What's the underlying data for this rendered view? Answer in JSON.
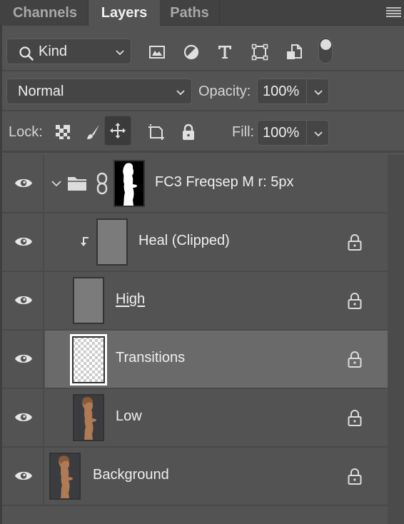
{
  "tabs": [
    {
      "label": "Channels",
      "active": false
    },
    {
      "label": "Layers",
      "active": true
    },
    {
      "label": "Paths",
      "active": false
    }
  ],
  "panel_menu_icon": "hamburger-menu-icon",
  "filter": {
    "kind_label": "Kind",
    "icons": [
      "image-filter-icon",
      "adjustment-filter-icon",
      "type-filter-icon",
      "shape-filter-icon",
      "smart-object-filter-icon"
    ],
    "filter_toggle_on": true
  },
  "blend": {
    "mode": "Normal",
    "opacity_label": "Opacity:",
    "opacity_value": "100%"
  },
  "lock": {
    "label": "Lock:",
    "icons": [
      "lock-transparent-pixels-icon",
      "lock-image-pixels-icon",
      "lock-position-icon",
      "lock-artboard-icon",
      "lock-all-icon"
    ],
    "selected": "lock-position-icon",
    "fill_label": "Fill:",
    "fill_value": "100%"
  },
  "layers": [
    {
      "name": "FC3 Freqsep M  r: 5px",
      "type": "group",
      "visible": true,
      "expanded": true,
      "linked_mask": true,
      "locked": false,
      "active": false,
      "underlined": false
    },
    {
      "name": "Heal (Clipped)",
      "type": "gray",
      "visible": true,
      "clipped": true,
      "locked": true,
      "active": false,
      "underlined": false
    },
    {
      "name": "High",
      "type": "gray",
      "visible": true,
      "locked": true,
      "active": false,
      "underlined": true
    },
    {
      "name": "Transitions",
      "type": "transparent",
      "visible": true,
      "locked": true,
      "active": true,
      "underlined": false
    },
    {
      "name": "Low",
      "type": "photo",
      "visible": true,
      "locked": true,
      "active": false,
      "underlined": false
    },
    {
      "name": "Background",
      "type": "photo",
      "visible": true,
      "locked": true,
      "active": false,
      "underlined": false
    }
  ]
}
